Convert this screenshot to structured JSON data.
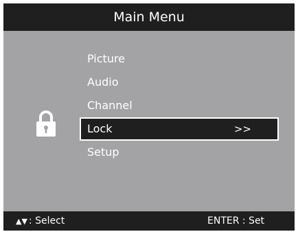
{
  "header": {
    "title": "Main Menu"
  },
  "menu": {
    "items": [
      {
        "label": "Picture",
        "selected": false
      },
      {
        "label": "Audio",
        "selected": false
      },
      {
        "label": "Channel",
        "selected": false
      },
      {
        "label": "Lock",
        "selected": true,
        "indicator": ">>"
      },
      {
        "label": "Setup",
        "selected": false
      }
    ]
  },
  "icons": {
    "side_icon": "lock-icon"
  },
  "footer": {
    "nav_arrows": "▲▼",
    "select_hint": ": Select",
    "enter_hint": "ENTER : Set"
  },
  "colors": {
    "background": "#a3a3a5",
    "bar": "#1f1f1f",
    "text": "#ffffff"
  }
}
